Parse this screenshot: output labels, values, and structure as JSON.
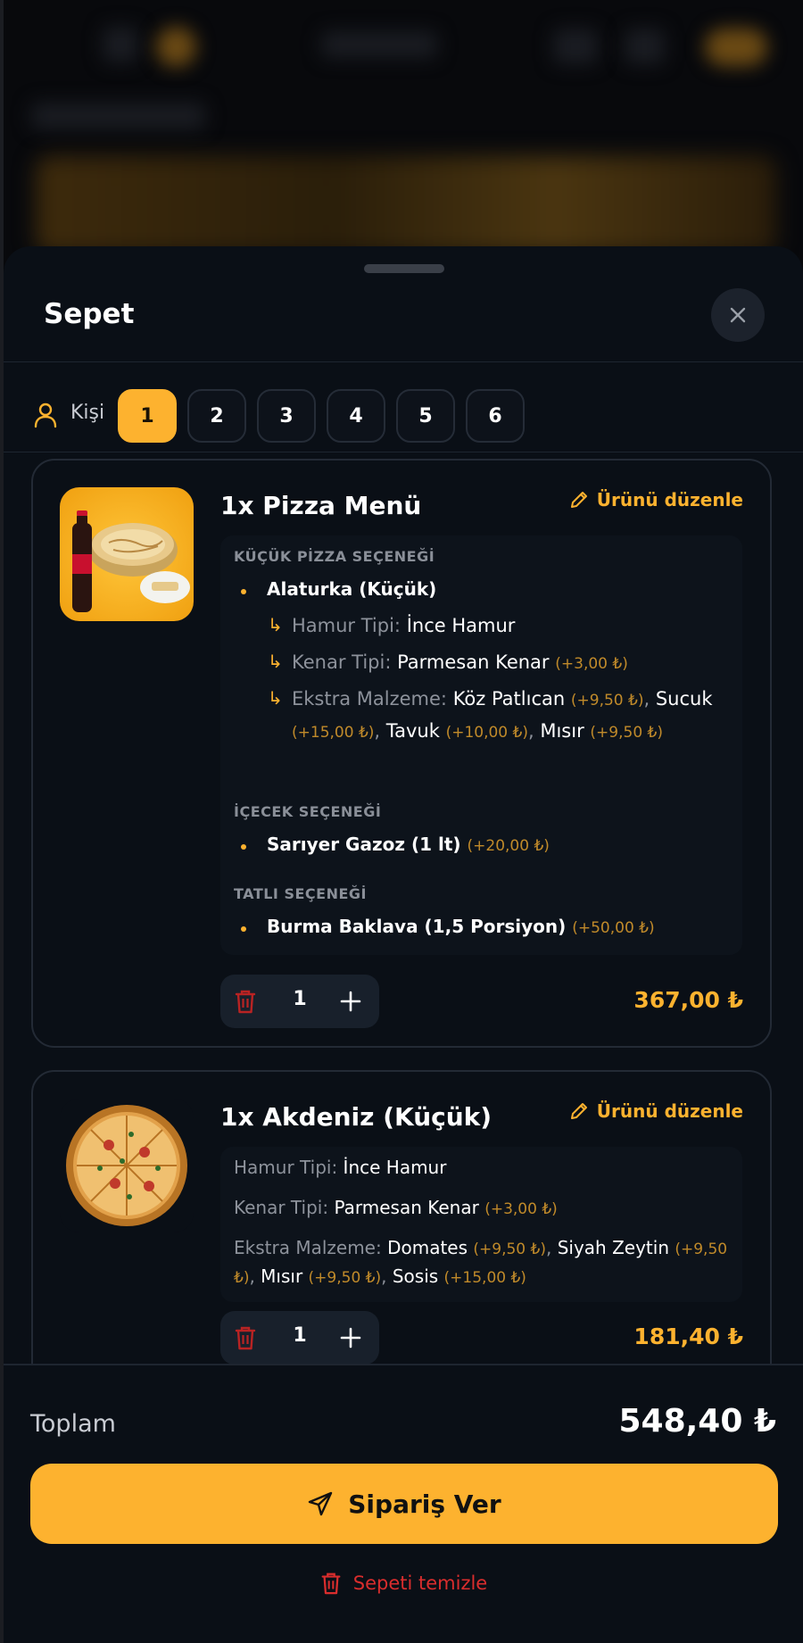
{
  "sheet": {
    "title": "Sepet",
    "close_icon": "x-icon"
  },
  "persons": {
    "label": "Kişi",
    "options": [
      "1",
      "2",
      "3",
      "4",
      "5",
      "6"
    ],
    "selected": "1"
  },
  "items": [
    {
      "title": "1x Pizza Menü",
      "edit_label": "Ürünü düzenle",
      "image": "pizza-menu-with-cola-image",
      "sections": [
        {
          "heading": "KÜÇÜK PİZZA SEÇENEĞİ",
          "option": "Alaturka (Küçük)",
          "subs": [
            {
              "label": "Hamur Tipi:",
              "value": "İnce Hamur"
            },
            {
              "label": "Kenar Tipi:",
              "value": "Parmesan Kenar",
              "price": "(+3,00 ₺)"
            },
            {
              "label": "Ekstra Malzeme:",
              "values": [
                {
                  "name": "Köz Patlıcan",
                  "price": "(+9,50 ₺)"
                },
                {
                  "name": "Sucuk",
                  "price": "(+15,00 ₺)"
                },
                {
                  "name": "Tavuk",
                  "price": "(+10,00 ₺)"
                },
                {
                  "name": "Mısır",
                  "price": "(+9,50 ₺)"
                }
              ]
            }
          ]
        },
        {
          "heading": "İÇECEK SEÇENEĞİ",
          "option": "Sarıyer Gazoz (1 lt)",
          "option_price": "(+20,00 ₺)"
        },
        {
          "heading": "TATLI SEÇENEĞİ",
          "option": "Burma Baklava (1,5 Porsiyon)",
          "option_price": "(+50,00 ₺)"
        }
      ],
      "quantity": "1",
      "price": "367,00 ₺"
    },
    {
      "title": "1x Akdeniz (Küçük)",
      "edit_label": "Ürünü düzenle",
      "image": "pizza-image",
      "details": [
        {
          "label": "Hamur Tipi:",
          "value": "İnce Hamur"
        },
        {
          "label": "Kenar Tipi:",
          "value": "Parmesan Kenar",
          "price": "(+3,00 ₺)"
        },
        {
          "label": "Ekstra Malzeme:",
          "values": [
            {
              "name": "Domates",
              "price": "(+9,50 ₺)"
            },
            {
              "name": "Siyah Zeytin",
              "price": "(+9,50 ₺)"
            },
            {
              "name": "Mısır",
              "price": "(+9,50 ₺)"
            },
            {
              "name": "Sosis",
              "price": "(+15,00 ₺)"
            }
          ]
        }
      ],
      "quantity": "1",
      "price": "181,40 ₺"
    }
  ],
  "footer": {
    "total_label": "Toplam",
    "total_value": "548,40 ₺",
    "order_label": "Sipariş Ver",
    "clear_label": "Sepeti temizle"
  },
  "colors": {
    "accent": "#fdb22f",
    "danger": "#d92d2d",
    "sheet_bg": "#0a0f16"
  }
}
